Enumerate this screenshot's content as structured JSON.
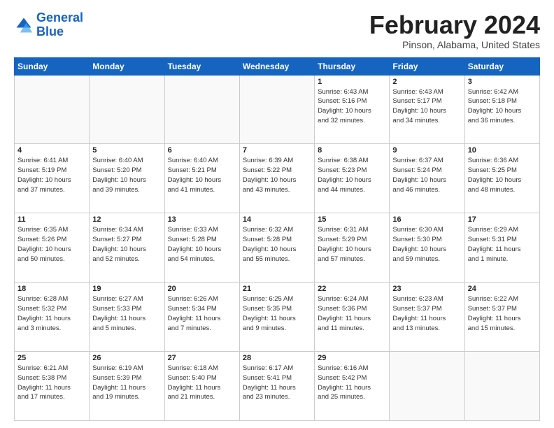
{
  "logo": {
    "text_general": "General",
    "text_blue": "Blue"
  },
  "header": {
    "month": "February 2024",
    "location": "Pinson, Alabama, United States"
  },
  "weekdays": [
    "Sunday",
    "Monday",
    "Tuesday",
    "Wednesday",
    "Thursday",
    "Friday",
    "Saturday"
  ],
  "weeks": [
    [
      {
        "day": "",
        "info": ""
      },
      {
        "day": "",
        "info": ""
      },
      {
        "day": "",
        "info": ""
      },
      {
        "day": "",
        "info": ""
      },
      {
        "day": "1",
        "info": "Sunrise: 6:43 AM\nSunset: 5:16 PM\nDaylight: 10 hours\nand 32 minutes."
      },
      {
        "day": "2",
        "info": "Sunrise: 6:43 AM\nSunset: 5:17 PM\nDaylight: 10 hours\nand 34 minutes."
      },
      {
        "day": "3",
        "info": "Sunrise: 6:42 AM\nSunset: 5:18 PM\nDaylight: 10 hours\nand 36 minutes."
      }
    ],
    [
      {
        "day": "4",
        "info": "Sunrise: 6:41 AM\nSunset: 5:19 PM\nDaylight: 10 hours\nand 37 minutes."
      },
      {
        "day": "5",
        "info": "Sunrise: 6:40 AM\nSunset: 5:20 PM\nDaylight: 10 hours\nand 39 minutes."
      },
      {
        "day": "6",
        "info": "Sunrise: 6:40 AM\nSunset: 5:21 PM\nDaylight: 10 hours\nand 41 minutes."
      },
      {
        "day": "7",
        "info": "Sunrise: 6:39 AM\nSunset: 5:22 PM\nDaylight: 10 hours\nand 43 minutes."
      },
      {
        "day": "8",
        "info": "Sunrise: 6:38 AM\nSunset: 5:23 PM\nDaylight: 10 hours\nand 44 minutes."
      },
      {
        "day": "9",
        "info": "Sunrise: 6:37 AM\nSunset: 5:24 PM\nDaylight: 10 hours\nand 46 minutes."
      },
      {
        "day": "10",
        "info": "Sunrise: 6:36 AM\nSunset: 5:25 PM\nDaylight: 10 hours\nand 48 minutes."
      }
    ],
    [
      {
        "day": "11",
        "info": "Sunrise: 6:35 AM\nSunset: 5:26 PM\nDaylight: 10 hours\nand 50 minutes."
      },
      {
        "day": "12",
        "info": "Sunrise: 6:34 AM\nSunset: 5:27 PM\nDaylight: 10 hours\nand 52 minutes."
      },
      {
        "day": "13",
        "info": "Sunrise: 6:33 AM\nSunset: 5:28 PM\nDaylight: 10 hours\nand 54 minutes."
      },
      {
        "day": "14",
        "info": "Sunrise: 6:32 AM\nSunset: 5:28 PM\nDaylight: 10 hours\nand 55 minutes."
      },
      {
        "day": "15",
        "info": "Sunrise: 6:31 AM\nSunset: 5:29 PM\nDaylight: 10 hours\nand 57 minutes."
      },
      {
        "day": "16",
        "info": "Sunrise: 6:30 AM\nSunset: 5:30 PM\nDaylight: 10 hours\nand 59 minutes."
      },
      {
        "day": "17",
        "info": "Sunrise: 6:29 AM\nSunset: 5:31 PM\nDaylight: 11 hours\nand 1 minute."
      }
    ],
    [
      {
        "day": "18",
        "info": "Sunrise: 6:28 AM\nSunset: 5:32 PM\nDaylight: 11 hours\nand 3 minutes."
      },
      {
        "day": "19",
        "info": "Sunrise: 6:27 AM\nSunset: 5:33 PM\nDaylight: 11 hours\nand 5 minutes."
      },
      {
        "day": "20",
        "info": "Sunrise: 6:26 AM\nSunset: 5:34 PM\nDaylight: 11 hours\nand 7 minutes."
      },
      {
        "day": "21",
        "info": "Sunrise: 6:25 AM\nSunset: 5:35 PM\nDaylight: 11 hours\nand 9 minutes."
      },
      {
        "day": "22",
        "info": "Sunrise: 6:24 AM\nSunset: 5:36 PM\nDaylight: 11 hours\nand 11 minutes."
      },
      {
        "day": "23",
        "info": "Sunrise: 6:23 AM\nSunset: 5:37 PM\nDaylight: 11 hours\nand 13 minutes."
      },
      {
        "day": "24",
        "info": "Sunrise: 6:22 AM\nSunset: 5:37 PM\nDaylight: 11 hours\nand 15 minutes."
      }
    ],
    [
      {
        "day": "25",
        "info": "Sunrise: 6:21 AM\nSunset: 5:38 PM\nDaylight: 11 hours\nand 17 minutes."
      },
      {
        "day": "26",
        "info": "Sunrise: 6:19 AM\nSunset: 5:39 PM\nDaylight: 11 hours\nand 19 minutes."
      },
      {
        "day": "27",
        "info": "Sunrise: 6:18 AM\nSunset: 5:40 PM\nDaylight: 11 hours\nand 21 minutes."
      },
      {
        "day": "28",
        "info": "Sunrise: 6:17 AM\nSunset: 5:41 PM\nDaylight: 11 hours\nand 23 minutes."
      },
      {
        "day": "29",
        "info": "Sunrise: 6:16 AM\nSunset: 5:42 PM\nDaylight: 11 hours\nand 25 minutes."
      },
      {
        "day": "",
        "info": ""
      },
      {
        "day": "",
        "info": ""
      }
    ]
  ]
}
